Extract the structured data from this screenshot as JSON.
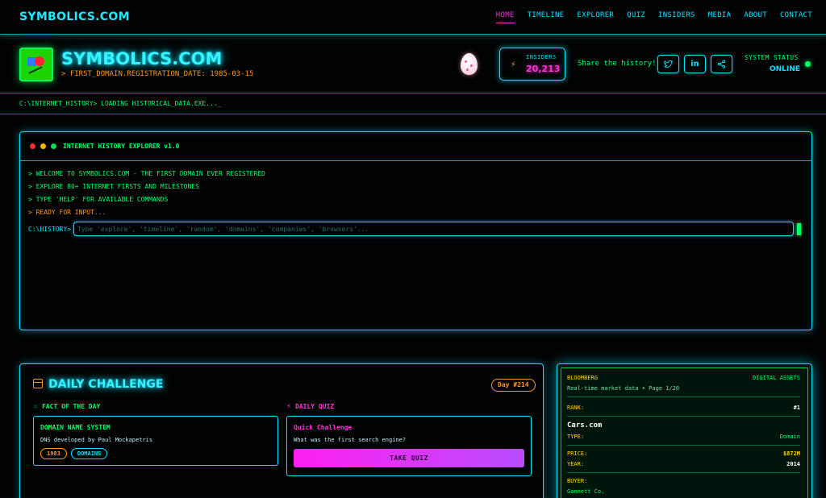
{
  "nav": {
    "brand": "SYMBOLICS.COM",
    "links": [
      "HOME",
      "TIMELINE",
      "EXPLORER",
      "QUIZ",
      "INSIDERS",
      "MEDIA",
      "ABOUT",
      "CONTACT"
    ]
  },
  "header": {
    "title": "SYMBOLICS.COM",
    "subtitle": "> FIRST_DOMAIN.REGISTRATION_DATE: 1985-03-15",
    "insiders_label": "INSIDERS",
    "insiders_count": "20,213",
    "share_label": "Share the history!",
    "share_icons": [
      "twitter-icon",
      "linkedin-icon",
      "share-icon"
    ],
    "system_status_label": "SYSTEM STATUS",
    "system_status_value": "ONLINE"
  },
  "cmdline": {
    "text": "C:\\INTERNET_HISTORY> LOADING HISTORICAL_DATA.EXE..._"
  },
  "terminal": {
    "title": "INTERNET HISTORY EXPLORER v1.0",
    "lines": [
      "> WELCOME TO SYMBOLICS.COM - THE FIRST DOMAIN EVER REGISTERED",
      "> EXPLORE 80+ INTERNET FIRSTS AND MILESTONES",
      "> TYPE 'HELP' FOR AVAILABLE COMMANDS",
      "> READY FOR INPUT..."
    ],
    "prompt": "C:\\HISTORY>",
    "placeholder": "Type 'explore', 'timeline', 'random', 'domains', 'companies', 'browsers'..."
  },
  "daily": {
    "title": "DAILY CHALLENGE",
    "day_badge": "Day #214",
    "fact_heading": "FACT OF THE DAY",
    "fact_title": "DOMAIN NAME SYSTEM",
    "fact_desc": "DNS developed by Paul Mockapetris",
    "fact_tags": [
      "1983",
      "DOMAINS"
    ],
    "quiz_heading": "DAILY QUIZ",
    "quiz_title": "Quick Challenge",
    "quiz_question": "What was the first search engine?",
    "quiz_button": "TAKE QUIZ"
  },
  "bloomberg": {
    "source": "BLOOMBERG",
    "category": "DIGITAL ASSETS",
    "subtitle": "Real-time market data • Page 1/20",
    "rank_label": "RANK:",
    "rank_value": "#1",
    "name": "Cars.com",
    "type_label": "TYPE:",
    "type_value": "Domain",
    "price_label": "PRICE:",
    "price_value": "$872M",
    "year_label": "YEAR:",
    "year_value": "2014",
    "buyer_label": "BUYER:",
    "buyer_value": "Gannett Co."
  },
  "colors": {
    "cyan": "#00e5ff",
    "green": "#00ff66",
    "orange": "#ff9a1f",
    "magenta": "#ff35d4"
  }
}
